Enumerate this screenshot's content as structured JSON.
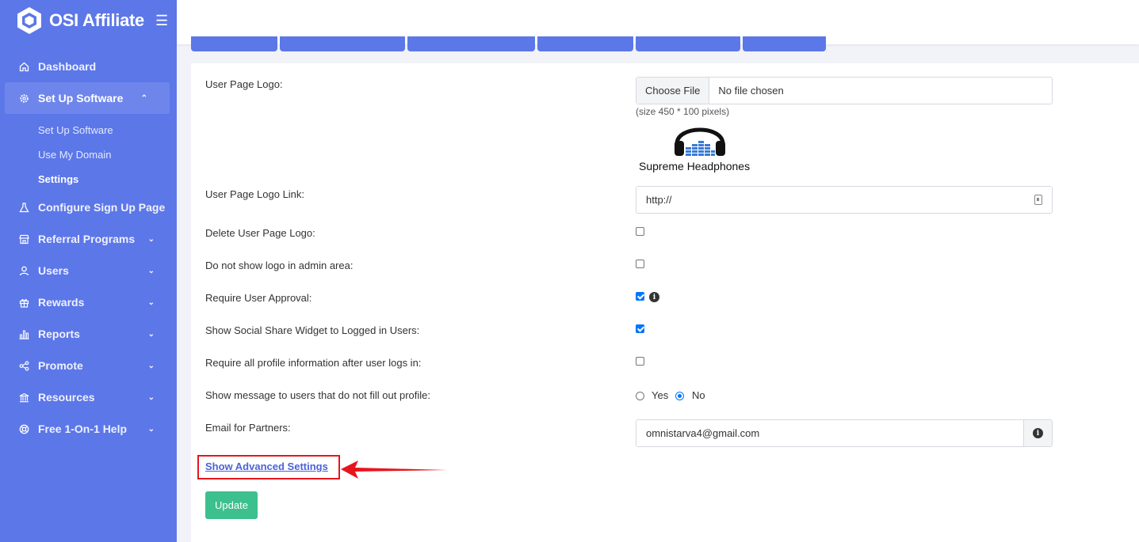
{
  "brand": {
    "name": "OSI Affiliate",
    "menu_icon": "hamburger-icon"
  },
  "sidebar": {
    "items": [
      {
        "label": "Dashboard",
        "icon": "home-icon"
      },
      {
        "label": "Set Up Software",
        "icon": "gear-icon",
        "expanded": true
      },
      {
        "label": "Configure Sign Up Page",
        "icon": "flask-icon"
      },
      {
        "label": "Referral Programs",
        "icon": "store-icon"
      },
      {
        "label": "Users",
        "icon": "user-icon"
      },
      {
        "label": "Rewards",
        "icon": "gift-icon"
      },
      {
        "label": "Reports",
        "icon": "bar-chart-icon"
      },
      {
        "label": "Promote",
        "icon": "share-icon"
      },
      {
        "label": "Resources",
        "icon": "bank-icon"
      },
      {
        "label": "Free 1-On-1 Help",
        "icon": "lifebuoy-icon"
      }
    ],
    "subitems": [
      {
        "label": "Set Up Software"
      },
      {
        "label": "Use My Domain"
      },
      {
        "label": "Settings",
        "current": true
      }
    ]
  },
  "form": {
    "user_page_logo": {
      "label": "User Page Logo:",
      "button": "Choose File",
      "file": "No file chosen",
      "hint": "(size 450 * 100 pixels)",
      "logo_caption": "Supreme Headphones"
    },
    "logo_link": {
      "label": "User Page Logo Link:",
      "value": "http://"
    },
    "delete_logo": {
      "label": "Delete User Page Logo:",
      "checked": false
    },
    "hide_logo_admin": {
      "label": "Do not show logo in admin area:",
      "checked": false
    },
    "require_approval": {
      "label": "Require User Approval:",
      "checked": true
    },
    "social_share": {
      "label": "Show Social Share Widget to Logged in Users:",
      "checked": true
    },
    "require_profile": {
      "label": "Require all profile information after user logs in:",
      "checked": false
    },
    "show_message": {
      "label": "Show message to users that do not fill out profile:",
      "yes": "Yes",
      "no": "No",
      "selected": "No"
    },
    "email_partners": {
      "label": "Email for Partners:",
      "value": "omnistarva4@gmail.com"
    },
    "advanced_link": "Show Advanced Settings",
    "update_button": "Update"
  },
  "colors": {
    "sidebar": "#5c77e8",
    "update": "#3cc08e",
    "annotation": "#e8141c",
    "checkbox": "#0075ff"
  }
}
